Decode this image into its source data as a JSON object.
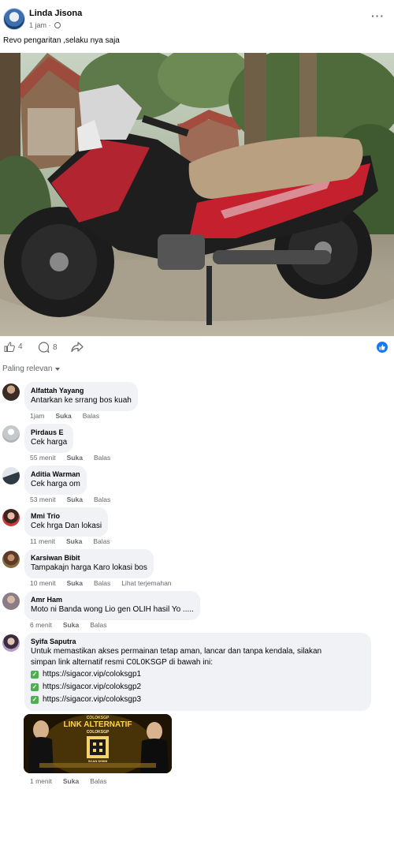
{
  "post": {
    "author": "Linda Jisona",
    "time": "1 jam ·",
    "caption": "Revo pengaritan ,selaku nya saja",
    "more": "···"
  },
  "actions": {
    "likes": "4",
    "comments": "8"
  },
  "sort_label": "Paling relevan",
  "comments": [
    {
      "name": "Alfattah Yayang",
      "text": "Antarkan ke srrang bos kuah",
      "time": "1jam",
      "like": "Suka",
      "reply": "Balas"
    },
    {
      "name": "Pirdaus E",
      "text": "Cek harga",
      "time": "55 menit",
      "like": "Suka",
      "reply": "Balas"
    },
    {
      "name": "Aditia Warman",
      "text": "Cek harga om",
      "time": "53 menit",
      "like": "Suka",
      "reply": "Balas"
    },
    {
      "name": "Mmi Trio",
      "text": "Cek hrga Dan lokasi",
      "time": "11 menit",
      "like": "Suka",
      "reply": "Balas"
    },
    {
      "name": "Karsiwan Bibit",
      "text": "Tampakajn harga Karo lokasi bos",
      "time": "10 menit",
      "like": "Suka",
      "reply": "Balas",
      "translate": "Lihat terjemahan"
    },
    {
      "name": "Amr Ham",
      "text": "Moto ni Banda wong Lio gen OLIH hasil Yo .....",
      "time": "6 menit",
      "like": "Suka",
      "reply": "Balas"
    },
    {
      "name": "Syifa Saputra",
      "text_line1": "Untuk memastikan akses permainan tetap aman, lancar dan tanpa kendala, silakan",
      "text_line2": "simpan link alternatif resmi C0L0KSGP di bawah ini:",
      "links": [
        "https://sigacor.vip/coloksgp1",
        "https://sigacor.vip/coloksgp2",
        "https://sigacor.vip/coloksgp3"
      ],
      "time": "1 menit",
      "like": "Suka",
      "reply": "Balas"
    }
  ],
  "promo": {
    "brand": "COLOKSGP",
    "title": "LINK ALTERNATIF",
    "subtitle": "COLOKSGP",
    "scan": "SCAN DISINI"
  }
}
